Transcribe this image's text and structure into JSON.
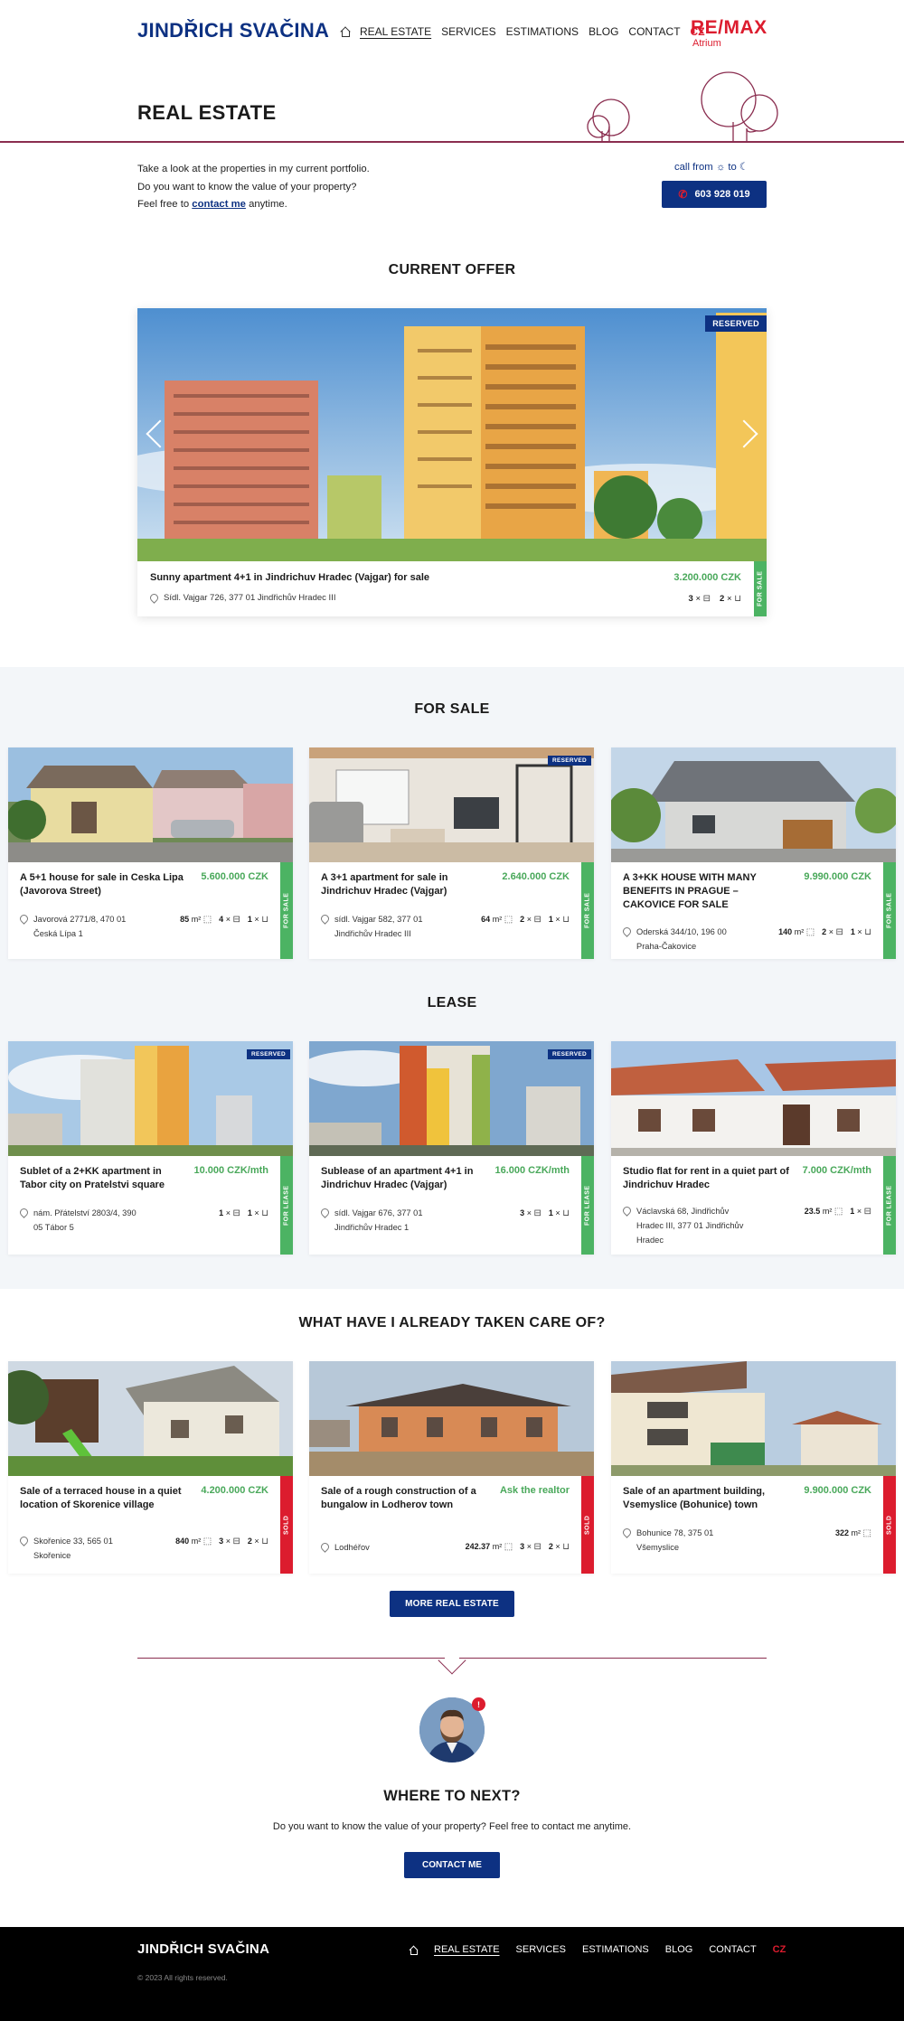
{
  "header": {
    "logo": "JINDŘICH SVAČINA",
    "nav": [
      "REAL ESTATE",
      "SERVICES",
      "ESTIMATIONS",
      "BLOG",
      "CONTACT"
    ],
    "lang": "CZ",
    "brand_main": "RE/MAX",
    "brand_sub": "Atrium"
  },
  "hero": {
    "title": "REAL ESTATE",
    "line1": "Take a look at the properties in my current portfolio.",
    "line2": "Do you want to know the value of your property?",
    "line3_pre": "Feel free to",
    "line3_link": "contact me",
    "line3_post": "anytime.",
    "call_from": "call from",
    "call_to": "to",
    "phone": "603 928 019"
  },
  "current_offer": {
    "heading": "CURRENT OFFER",
    "badge": "RESERVED",
    "title": "Sunny apartment 4+1 in Jindrichuv Hradec (Vajgar) for sale",
    "price": "3.200.000 CZK",
    "address": "Sídl. Vajgar 726, 377 01 Jindřichův Hradec III",
    "rooms": "3",
    "baths": "2",
    "status": "FOR SALE"
  },
  "for_sale": {
    "heading": "FOR SALE",
    "items": [
      {
        "title": "A 5+1 house for sale in Ceska Lipa (Javorova Street)",
        "price": "5.600.000 CZK",
        "addr1": "Javorová 2771/8, 470 01",
        "addr2": "Česká Lípa 1",
        "area": "85",
        "rooms": "4",
        "baths": "1",
        "status": "FOR SALE",
        "badge": ""
      },
      {
        "title": "A 3+1 apartment for sale in Jindrichuv Hradec (Vajgar)",
        "price": "2.640.000 CZK",
        "addr1": "sídl. Vajgar 582, 377 01",
        "addr2": "Jindřichův Hradec III",
        "area": "64",
        "rooms": "2",
        "baths": "1",
        "status": "FOR SALE",
        "badge": "RESERVED"
      },
      {
        "title": "A 3+KK HOUSE WITH MANY BENEFITS IN PRAGUE – CAKOVICE FOR SALE",
        "price": "9.990.000 CZK",
        "addr1": "Oderská 344/10, 196 00",
        "addr2": "Praha-Čakovice",
        "area": "140",
        "rooms": "2",
        "baths": "1",
        "status": "FOR SALE",
        "badge": ""
      }
    ]
  },
  "lease": {
    "heading": "LEASE",
    "items": [
      {
        "title": "Sublet of a 2+KK apartment in Tabor city on Pratelstvi square",
        "price": "10.000 CZK/mth",
        "addr1": "nám. Přátelství 2803/4, 390",
        "addr2": "05 Tábor 5",
        "rooms": "1",
        "baths": "1",
        "status": "FOR LEASE",
        "badge": "RESERVED"
      },
      {
        "title": "Sublease of an apartment 4+1 in Jindrichuv Hradec (Vajgar)",
        "price": "16.000 CZK/mth",
        "addr1": "sídl. Vajgar 676, 377 01",
        "addr2": "Jindřichův Hradec 1",
        "rooms": "3",
        "baths": "1",
        "status": "FOR LEASE",
        "badge": "RESERVED"
      },
      {
        "title": "Studio flat for rent in a quiet part of Jindrichuv Hradec",
        "price": "7.000 CZK/mth",
        "addr1": "Václavská 68, Jindřichův",
        "addr2": "Hradec III, 377 01 Jindřichův",
        "addr3": "Hradec",
        "area": "23.5",
        "rooms": "1",
        "status": "FOR LEASE",
        "badge": ""
      }
    ]
  },
  "sold": {
    "heading": "WHAT HAVE I ALREADY TAKEN CARE OF?",
    "items": [
      {
        "title": "Sale of a terraced house in a quiet location of Skorenice village",
        "price": "4.200.000 CZK",
        "addr1": "Skořenice 33, 565 01",
        "addr2": "Skořenice",
        "area": "840",
        "rooms": "3",
        "baths": "2",
        "status": "SOLD"
      },
      {
        "title": "Sale of a rough construction of a bungalow in Lodherov town",
        "price": "Ask the realtor",
        "addr1": "Lodhéřov",
        "area": "242.37",
        "rooms": "3",
        "baths": "2",
        "status": "SOLD"
      },
      {
        "title": "Sale of an apartment building, Vsemyslice (Bohunice) town",
        "price": "9.900.000 CZK",
        "addr1": "Bohunice 78, 375 01",
        "addr2": "Všemyslice",
        "area": "322",
        "status": "SOLD"
      }
    ]
  },
  "more_button": "MORE REAL ESTATE",
  "where": {
    "heading": "WHERE TO NEXT?",
    "text": "Do you want to know the value of your property?  Feel free to contact me anytime.",
    "button": "CONTACT ME",
    "notification": "!"
  },
  "footer": {
    "logo": "JINDŘICH SVAČINA",
    "copyright": "© 2023 All rights reserved.",
    "nav": [
      "REAL ESTATE",
      "SERVICES",
      "ESTIMATIONS",
      "BLOG",
      "CONTACT"
    ],
    "lang": "CZ"
  },
  "units": {
    "m2": "m²",
    "times": "×"
  },
  "colors": {
    "brand_blue": "#0d3182",
    "accent_red": "#dc1c2e",
    "sale_green": "#4cb363",
    "line": "#8a2d4f"
  }
}
